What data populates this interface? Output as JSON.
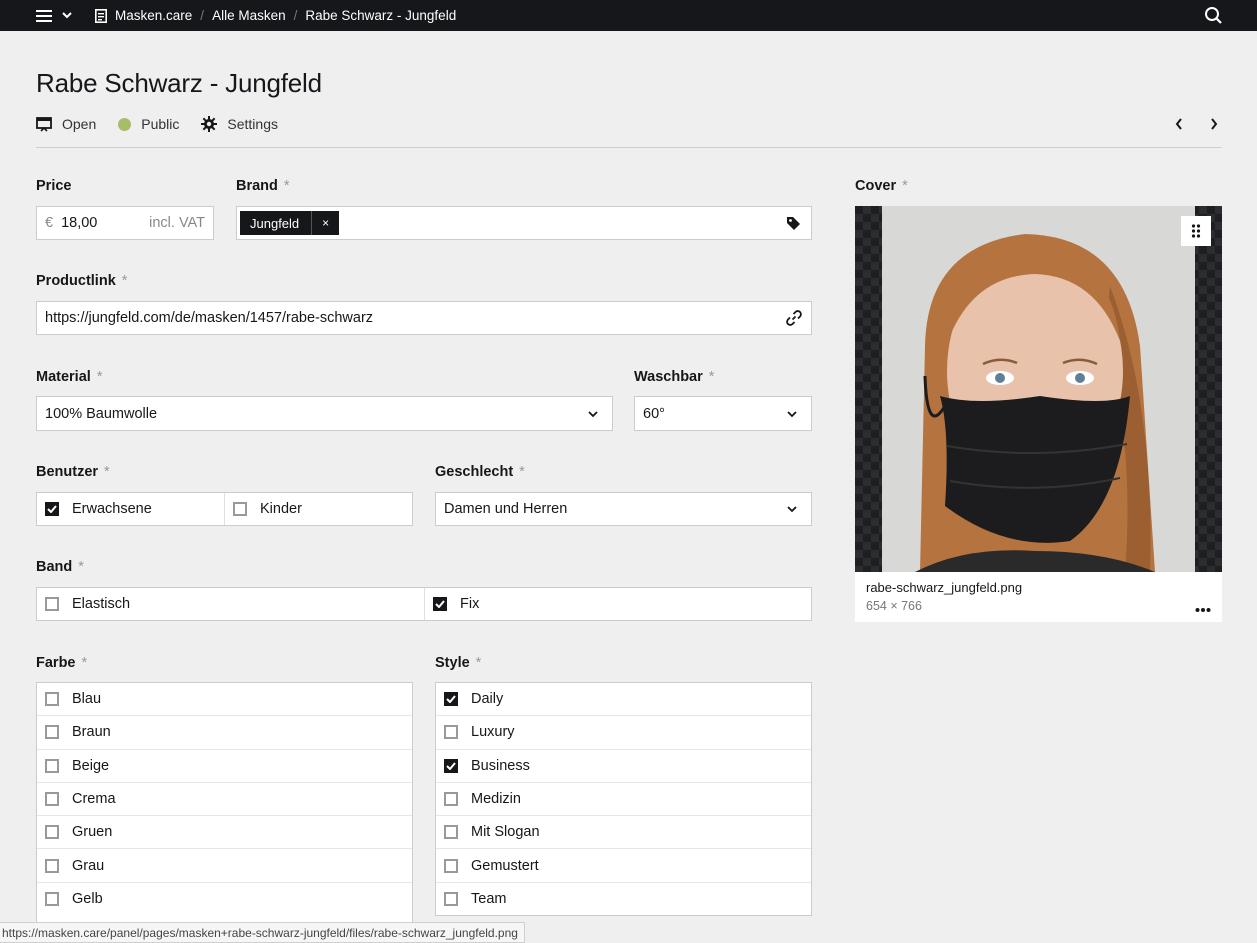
{
  "topbar": {
    "breadcrumbs": [
      "Masken.care",
      "Alle Masken",
      "Rabe Schwarz - Jungfeld"
    ]
  },
  "header": {
    "title": "Rabe Schwarz - Jungfeld",
    "open_label": "Open",
    "status_label": "Public",
    "status_color": "#a7bd68",
    "settings_label": "Settings"
  },
  "fields": {
    "price": {
      "label": "Price",
      "currency": "€",
      "value": "18,00",
      "suffix": "incl. VAT"
    },
    "brand": {
      "label": "Brand",
      "required": "*",
      "tag": "Jungfeld",
      "remove": "×"
    },
    "productlink": {
      "label": "Productlink",
      "required": "*",
      "value": "https://jungfeld.com/de/masken/1457/rabe-schwarz"
    },
    "material": {
      "label": "Material",
      "required": "*",
      "value": "100% Baumwolle"
    },
    "waschbar": {
      "label": "Waschbar",
      "required": "*",
      "value": "60°"
    },
    "benutzer": {
      "label": "Benutzer",
      "required": "*",
      "options": [
        {
          "label": "Erwachsene",
          "checked": true
        },
        {
          "label": "Kinder",
          "checked": false
        }
      ]
    },
    "geschlecht": {
      "label": "Geschlecht",
      "required": "*",
      "value": "Damen und Herren"
    },
    "band": {
      "label": "Band",
      "required": "*",
      "options": [
        {
          "label": "Elastisch",
          "checked": false
        },
        {
          "label": "Fix",
          "checked": true
        }
      ]
    },
    "farbe": {
      "label": "Farbe",
      "required": "*",
      "options": [
        {
          "label": "Blau",
          "checked": false
        },
        {
          "label": "Braun",
          "checked": false
        },
        {
          "label": "Beige",
          "checked": false
        },
        {
          "label": "Crema",
          "checked": false
        },
        {
          "label": "Gruen",
          "checked": false
        },
        {
          "label": "Grau",
          "checked": false
        },
        {
          "label": "Gelb",
          "checked": false
        }
      ]
    },
    "style": {
      "label": "Style",
      "required": "*",
      "options": [
        {
          "label": "Daily",
          "checked": true
        },
        {
          "label": "Luxury",
          "checked": false
        },
        {
          "label": "Business",
          "checked": true
        },
        {
          "label": "Medizin",
          "checked": false
        },
        {
          "label": "Mit Slogan",
          "checked": false
        },
        {
          "label": "Gemustert",
          "checked": false
        },
        {
          "label": "Team",
          "checked": false
        }
      ]
    }
  },
  "cover": {
    "label": "Cover",
    "required": "*",
    "filename": "rabe-schwarz_jungfeld.png",
    "dimensions": "654 × 766"
  },
  "statusbar": {
    "url": "https://masken.care/panel/pages/masken+rabe-schwarz-jungfeld/files/rabe-schwarz_jungfeld.png"
  }
}
